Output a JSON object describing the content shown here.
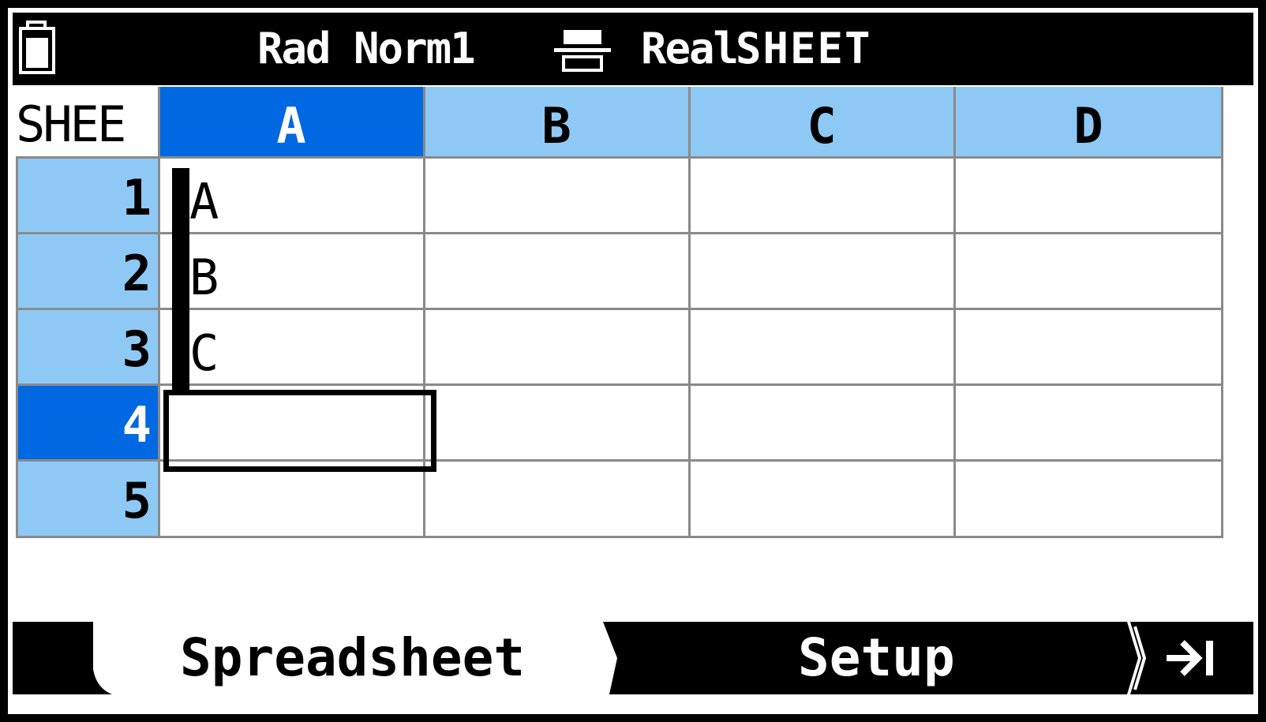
{
  "status_bar": {
    "battery_icon": "battery-icon",
    "angle_format_mode": "Rad Norm1",
    "fraction_icon": "fraction-format-icon",
    "complex_mode": "Real",
    "app_name": "SHEET"
  },
  "sheet": {
    "corner_label": "SHEE",
    "columns": [
      "A",
      "B",
      "C",
      "D"
    ],
    "selected_column": "A",
    "rows": [
      "1",
      "2",
      "3",
      "4",
      "5"
    ],
    "selected_row": "4",
    "cells": [
      [
        "A",
        "",
        "",
        ""
      ],
      [
        "B",
        "",
        "",
        ""
      ],
      [
        "C",
        "",
        "",
        ""
      ],
      [
        "",
        "",
        "",
        ""
      ],
      [
        "",
        "",
        "",
        ""
      ]
    ]
  },
  "function_keys": {
    "spreadsheet_label": "Spreadsheet",
    "setup_label": "Setup",
    "jump_icon": "jump-to-end-icon"
  },
  "colors": {
    "header_light_blue": "#8ec9f5",
    "selection_blue": "#0068e0",
    "grid_line": "#8a8a8a",
    "bar_black": "#000000"
  }
}
